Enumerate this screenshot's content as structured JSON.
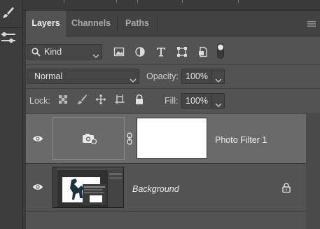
{
  "tabs": [
    {
      "label": "Layers",
      "active": true
    },
    {
      "label": "Channels",
      "active": false
    },
    {
      "label": "Paths",
      "active": false
    }
  ],
  "filter": {
    "kind_label": "Kind",
    "icons": [
      "image-filter-icon",
      "adjustment-filter-icon",
      "type-filter-icon",
      "shape-filter-icon",
      "smart-object-filter-icon",
      "filter-toggle-icon"
    ]
  },
  "blend": {
    "mode": "Normal",
    "opacity_label": "Opacity:",
    "opacity_value": "100%"
  },
  "lock": {
    "label": "Lock:",
    "icons": [
      "lock-transparent-pixels-icon",
      "lock-image-pixels-icon",
      "lock-position-icon",
      "lock-artboard-icon",
      "lock-all-icon"
    ],
    "fill_label": "Fill:",
    "fill_value": "100%"
  },
  "layers": [
    {
      "name": "Photo Filter 1",
      "visible": true,
      "selected": true,
      "type": "adjustment"
    },
    {
      "name": "Background",
      "visible": true,
      "selected": false,
      "locked": true,
      "type": "background"
    }
  ],
  "colors": {
    "panel": "#535353",
    "tabbar": "#424242",
    "selected_layer": "#6a6a6a",
    "text": "#d6d6d6"
  }
}
